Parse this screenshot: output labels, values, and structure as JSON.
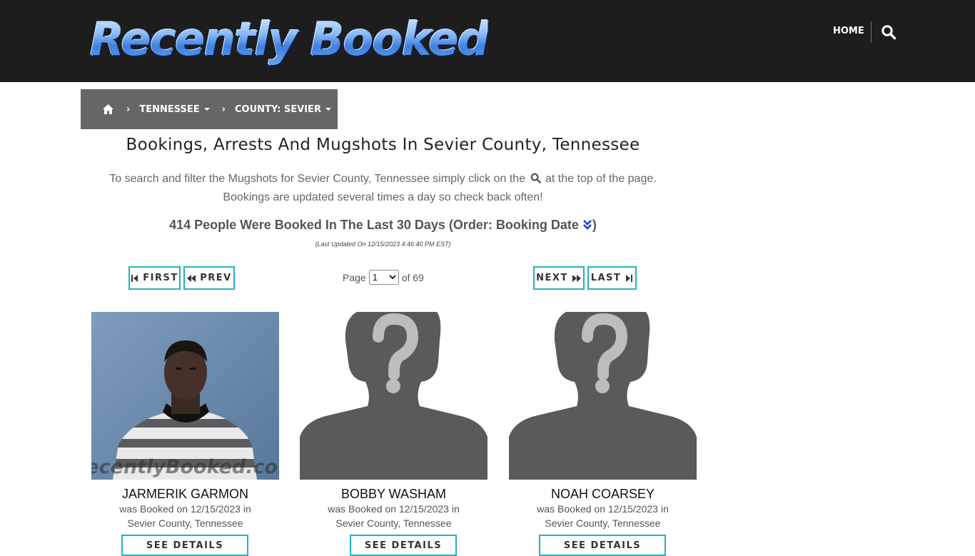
{
  "site": {
    "logo_text": "Recently Booked"
  },
  "nav": {
    "home_label": "HOME"
  },
  "breadcrumb": {
    "state_label": "TENNESSEE",
    "county_label": "COUNTY: SEVIER"
  },
  "page": {
    "title": "Bookings, Arrests And Mugshots In Sevier County, Tennessee",
    "intro_part1": "To search and filter the Mugshots for Sevier County, Tennessee simply click on the",
    "intro_part2": "at the top of the page.",
    "intro_line2": "Bookings are updated several times a day so check back often!",
    "count_text": "414 People Were Booked In The Last 30 Days (Order: Booking Date",
    "count_close": ")",
    "last_updated": "(Last Updated On 12/15/2023 4:46:40 PM EST)"
  },
  "pagination": {
    "first_label": "FIRST",
    "prev_label": "PREV",
    "next_label": "NEXT",
    "last_label": "LAST",
    "page_label": "Page",
    "current_page": "1",
    "of_label": "of 69"
  },
  "bookings": [
    {
      "name": "JARMERIK GARMON",
      "line1": "was Booked on 12/15/2023 in",
      "line2": "Sevier County, Tennessee",
      "details_label": "SEE DETAILS",
      "photo": "mugshot",
      "watermark": "RecentlyBooked.com"
    },
    {
      "name": "BOBBY WASHAM",
      "line1": "was Booked on 12/15/2023 in",
      "line2": "Sevier County, Tennessee",
      "details_label": "SEE DETAILS",
      "photo": "placeholder-silhouette"
    },
    {
      "name": "NOAH COARSEY",
      "line1": "was Booked on 12/15/2023 in",
      "line2": "Sevier County, Tennessee",
      "details_label": "SEE DETAILS",
      "photo": "placeholder-silhouette"
    }
  ],
  "colors": {
    "topbar": "#1d1d1d",
    "breadcrumb": "#666666",
    "accent_teal": "#27b2b4",
    "order_icon": "#1a3fd6"
  }
}
